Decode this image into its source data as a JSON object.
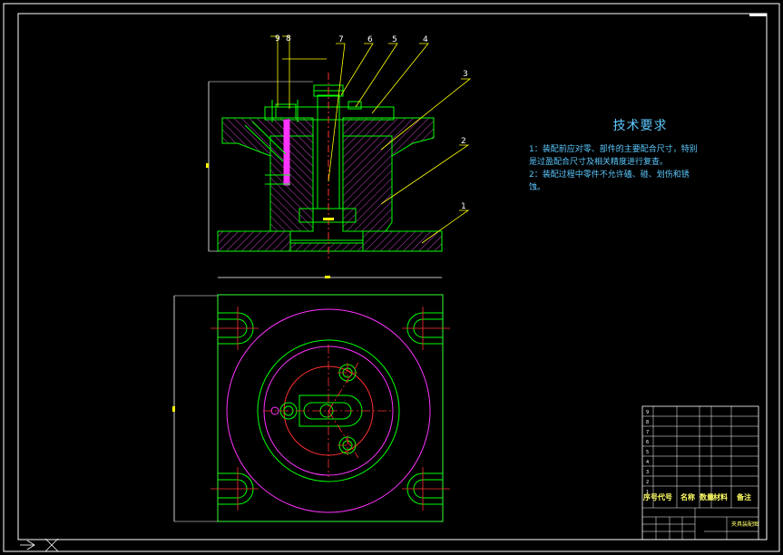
{
  "tech_requirements": {
    "title": "技术要求",
    "line1": "1：装配前应对零、部件的主要配合尺寸，特别",
    "line2": "是过盈配合尺寸及相关精度进行复查。",
    "line3": "2：装配过程中零件不允许磕、碰、划伤和锈",
    "line4": "蚀。"
  },
  "balloons": [
    "9",
    "8",
    "7",
    "6",
    "5",
    "4",
    "3",
    "2",
    "1"
  ],
  "title_block": {
    "headers": [
      "序号",
      "代号",
      "名称",
      "数量",
      "材料",
      "备注"
    ],
    "row_numbers": [
      "9",
      "8",
      "7",
      "6",
      "5",
      "4",
      "3",
      "2",
      "1"
    ],
    "drawing_name": "夹具装配图"
  },
  "colors": {
    "frame": "#ffffff",
    "outline": "#00ff00",
    "hatch": "#cc44cc",
    "centerline": "#ff3030",
    "leader": "#ffff00",
    "text": "#5cc8ff",
    "magenta_part": "#ff33ff"
  }
}
